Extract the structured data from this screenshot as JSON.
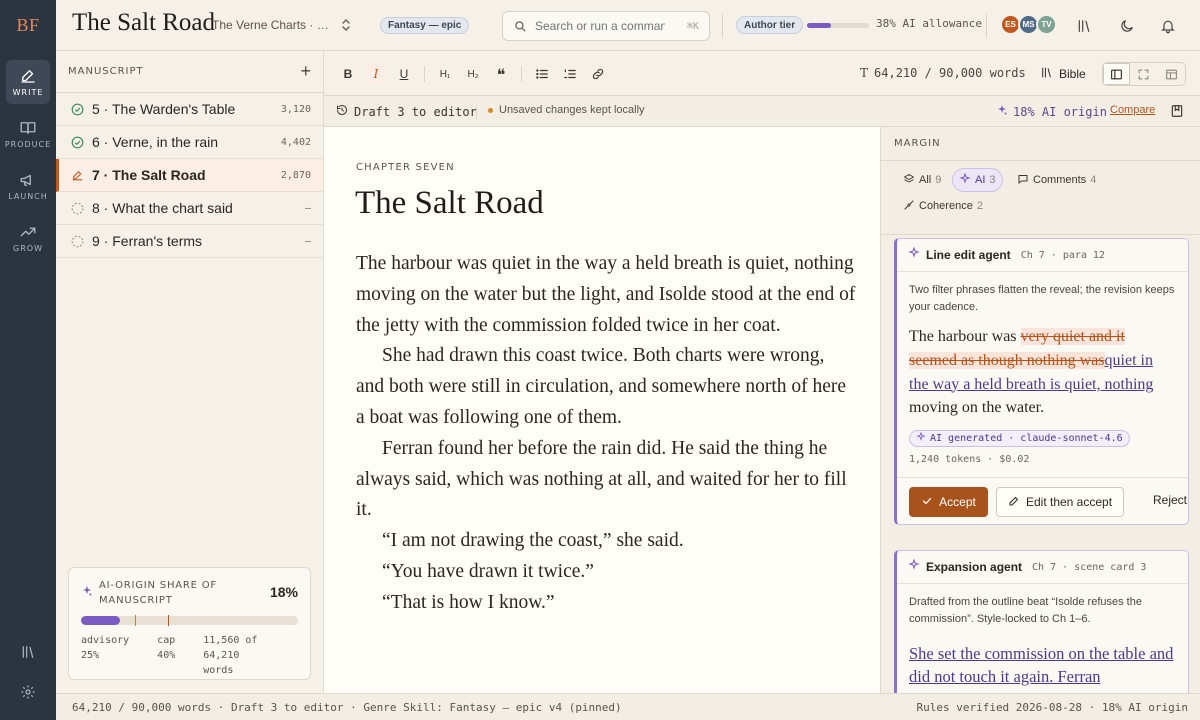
{
  "app": {
    "logo": "BF",
    "title": "The Salt Road",
    "subtitle": "The Verne Charts · Bo…",
    "genre_badge": "Fantasy — epic",
    "search_placeholder": "Search or run a command",
    "search_shortcut": "⌘K",
    "tier_badge": "Author tier",
    "allowance_label": "38% AI allowance",
    "allowance_fraction": 0.38,
    "avatars": [
      {
        "initials": "ES",
        "color": "#c2581f"
      },
      {
        "initials": "MS",
        "color": "#4f6b86"
      },
      {
        "initials": "TV",
        "color": "#7fa394"
      }
    ]
  },
  "rail": {
    "items": [
      {
        "label": "WRITE",
        "icon": "pen-icon",
        "active": true
      },
      {
        "label": "PRODUCE",
        "icon": "book-icon",
        "active": false
      },
      {
        "label": "LAUNCH",
        "icon": "megaphone-icon",
        "active": false
      },
      {
        "label": "GROW",
        "icon": "trend-icon",
        "active": false
      }
    ]
  },
  "manuscript": {
    "label": "MANUSCRIPT",
    "chapters": [
      {
        "title": "5 · The Warden's Table",
        "words": "3,120",
        "status": "done"
      },
      {
        "title": "6 · Verne, in the rain",
        "words": "4,402",
        "status": "done"
      },
      {
        "title": "7 · The Salt Road",
        "words": "2,870",
        "status": "active"
      },
      {
        "title": "8 · What the chart said",
        "words": "–",
        "status": "todo"
      },
      {
        "title": "9 · Ferran's terms",
        "words": "–",
        "status": "todo"
      }
    ],
    "ai_share": {
      "title": "AI-ORIGIN SHARE OF MANUSCRIPT",
      "percent": "18%",
      "fraction": 0.18,
      "advisory_fraction": 0.25,
      "cap_fraction": 0.4,
      "advisory_label": "advisory",
      "advisory_value": "25%",
      "cap_label": "cap",
      "cap_value": "40%",
      "words_line1": "11,560 of",
      "words_line2": "64,210 words"
    }
  },
  "toolbar": {
    "word_count": "64,210 / 90,000 words",
    "bible_label": "Bible"
  },
  "draftbar": {
    "draft_label": "Draft 3 to editor",
    "unsaved_label": "Unsaved changes kept locally",
    "ai_origin": "18% AI origin",
    "compare_label": "Compare"
  },
  "editor": {
    "kicker": "CHAPTER SEVEN",
    "title": "The Salt Road",
    "paragraphs": [
      "The harbour was quiet in the way a held breath is quiet, nothing moving on the water but the light, and Isolde stood at the end of the jetty with the commission folded twice in her coat.",
      "She had drawn this coast twice. Both charts were wrong, and both were still in circulation, and somewhere north of here a boat was following one of them.",
      "Ferran found her before the rain did. He said the thing he always said, which was nothing at all, and waited for her to fill it.",
      "“I am not drawing the coast,” she said.",
      "“You have drawn it twice.”",
      "“That is how I know.”"
    ]
  },
  "margin": {
    "label": "MARGIN",
    "filters": {
      "all_label": "All",
      "all_count": "9",
      "ai_label": "AI",
      "ai_count": "3",
      "comments_label": "Comments",
      "comments_count": "4",
      "coherence_label": "Coherence",
      "coherence_count": "2"
    },
    "suggestion1": {
      "agent": "Line edit agent",
      "location": "Ch 7 · para 12",
      "note": "Two filter phrases flatten the reveal; the revision keeps your cadence.",
      "text_before": "The harbour was ",
      "text_deleted": "very quiet and it seemed as though nothing was",
      "text_inserted": "quiet in the way a held breath is quiet, nothing",
      "text_after": " moving on the water.",
      "chip": "AI generated · claude-sonnet-4.6",
      "tokens": "1,240 tokens · $0.02",
      "accept_label": "Accept",
      "edit_label": "Edit then accept",
      "reject_label": "Reject"
    },
    "suggestion2": {
      "agent": "Expansion agent",
      "location": "Ch 7 · scene card 3",
      "note": "Drafted from the outline beat “Isolde refuses the commission”. Style-locked to Ch 1–6.",
      "text": "She set the commission on the table and did not touch it again. Ferran"
    }
  },
  "status": {
    "left": "64,210 / 90,000 words  ·  Draft 3 to editor  ·  Genre Skill: Fantasy — epic v4 (pinned)",
    "right": "Rules verified 2026-08-28  ·  18% AI origin"
  },
  "colors": {
    "accent": "#c2581f",
    "ai_purple": "#7a5bc1",
    "rail_bg": "#2b3440"
  }
}
